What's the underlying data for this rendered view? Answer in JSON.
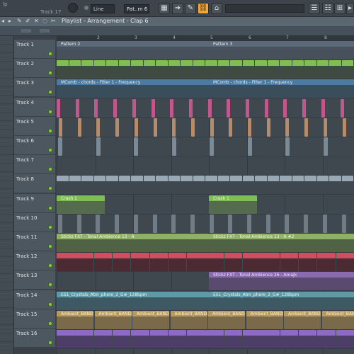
{
  "toolbar": {
    "tempo_label": "Track 17",
    "snap_value": "Line",
    "pattern_selector": "Pat..rn 6",
    "top_left_text": "lp"
  },
  "titlebar": {
    "breadcrumb": "Playlist - Arrangement - Clap 6"
  },
  "ruler": {
    "bars": [
      "2",
      "3",
      "4",
      "5",
      "6",
      "7",
      "8"
    ]
  },
  "tracks": [
    {
      "name": "Track 1"
    },
    {
      "name": "Track 2"
    },
    {
      "name": "Track 3"
    },
    {
      "name": "Track 4"
    },
    {
      "name": "Track 5"
    },
    {
      "name": "Track 6"
    },
    {
      "name": "Track 7"
    },
    {
      "name": "Track 8"
    },
    {
      "name": "Track 9"
    },
    {
      "name": "Track 10"
    },
    {
      "name": "Track 11"
    },
    {
      "name": "Track 12"
    },
    {
      "name": "Track 13"
    },
    {
      "name": "Track 14"
    },
    {
      "name": "Track 15"
    },
    {
      "name": "Track 16"
    }
  ],
  "clips": {
    "pattern2": "Pattern 2",
    "pattern3": "Pattern 3",
    "mcomb_a": "MComb - chords - Filter 1 - Frequency",
    "mcomb_b": "MComb - chords - Filter 1 - Frequency",
    "crash_a": "Crash 1",
    "crash_b": "Crash 1",
    "stickz_a": "Stickz FXT - Tonal Ambience 13 - A",
    "stickz_b": "Stickz FXT - Tonal Ambience 13 - A #2",
    "stickz_c": "Stickz FXT - Tonal Ambience 26 - Amajk",
    "crystals_a": "ES1_Crystals_Atm_phere_2_G#_128bpm",
    "crystals_b": "ES1_Crystals_Atm_phere_2_G#_128bpm",
    "ambient": "Ambient_BANDLAB"
  }
}
